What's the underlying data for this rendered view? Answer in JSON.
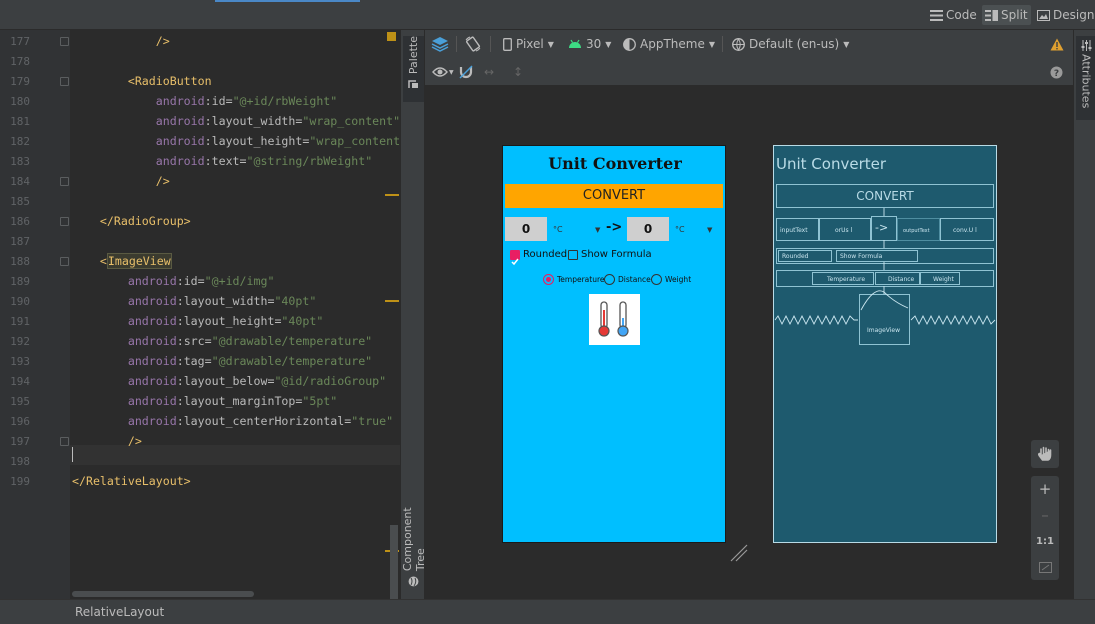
{
  "toolbar": {
    "modes": [
      {
        "label": "Code",
        "icon": "code-icon"
      },
      {
        "label": "Split",
        "icon": "split-icon",
        "active": true
      },
      {
        "label": "Design",
        "icon": "image-icon"
      }
    ]
  },
  "editor": {
    "lines": [
      {
        "n": "177",
        "parts": [
          {
            "t": "            ",
            "c": ""
          },
          {
            "t": "/>",
            "c": "tag"
          }
        ]
      },
      {
        "n": "178",
        "parts": []
      },
      {
        "n": "179",
        "parts": [
          {
            "t": "        ",
            "c": ""
          },
          {
            "t": "<RadioButton",
            "c": "tag"
          }
        ]
      },
      {
        "n": "180",
        "parts": [
          {
            "t": "            ",
            "c": ""
          },
          {
            "t": "android",
            "c": "ns"
          },
          {
            "t": ":id=",
            "c": "attr"
          },
          {
            "t": "\"@+id/rbWeight\"",
            "c": "val"
          }
        ]
      },
      {
        "n": "181",
        "parts": [
          {
            "t": "            ",
            "c": ""
          },
          {
            "t": "android",
            "c": "ns"
          },
          {
            "t": ":layout_width=",
            "c": "attr"
          },
          {
            "t": "\"wrap_content\"",
            "c": "val"
          }
        ]
      },
      {
        "n": "182",
        "parts": [
          {
            "t": "            ",
            "c": ""
          },
          {
            "t": "android",
            "c": "ns"
          },
          {
            "t": ":layout_height=",
            "c": "attr"
          },
          {
            "t": "\"wrap_content",
            "c": "val"
          }
        ]
      },
      {
        "n": "183",
        "parts": [
          {
            "t": "            ",
            "c": ""
          },
          {
            "t": "android",
            "c": "ns"
          },
          {
            "t": ":text=",
            "c": "attr"
          },
          {
            "t": "\"@string/rbWeight\"",
            "c": "val"
          }
        ]
      },
      {
        "n": "184",
        "parts": [
          {
            "t": "            ",
            "c": ""
          },
          {
            "t": "/>",
            "c": "tag"
          }
        ]
      },
      {
        "n": "185",
        "parts": []
      },
      {
        "n": "186",
        "parts": [
          {
            "t": "    ",
            "c": ""
          },
          {
            "t": "</RadioGroup>",
            "c": "tag"
          }
        ]
      },
      {
        "n": "187",
        "parts": []
      },
      {
        "n": "188",
        "parts": [
          {
            "t": "    ",
            "c": ""
          },
          {
            "t": "<",
            "c": "tag"
          },
          {
            "t": "ImageView",
            "c": "tag hl"
          }
        ]
      },
      {
        "n": "189",
        "parts": [
          {
            "t": "        ",
            "c": ""
          },
          {
            "t": "android",
            "c": "ns"
          },
          {
            "t": ":id=",
            "c": "attr"
          },
          {
            "t": "\"@+id/img\"",
            "c": "val"
          }
        ]
      },
      {
        "n": "190",
        "parts": [
          {
            "t": "        ",
            "c": ""
          },
          {
            "t": "android",
            "c": "ns"
          },
          {
            "t": ":layout_width=",
            "c": "attr"
          },
          {
            "t": "\"40pt\"",
            "c": "val"
          }
        ]
      },
      {
        "n": "191",
        "parts": [
          {
            "t": "        ",
            "c": ""
          },
          {
            "t": "android",
            "c": "ns"
          },
          {
            "t": ":layout_height=",
            "c": "attr"
          },
          {
            "t": "\"40pt\"",
            "c": "val"
          }
        ]
      },
      {
        "n": "192",
        "parts": [
          {
            "t": "        ",
            "c": ""
          },
          {
            "t": "android",
            "c": "ns"
          },
          {
            "t": ":src=",
            "c": "attr"
          },
          {
            "t": "\"@drawable/temperature\"",
            "c": "val"
          }
        ]
      },
      {
        "n": "193",
        "parts": [
          {
            "t": "        ",
            "c": ""
          },
          {
            "t": "android",
            "c": "ns"
          },
          {
            "t": ":tag=",
            "c": "attr"
          },
          {
            "t": "\"@drawable/temperature\"",
            "c": "val"
          }
        ]
      },
      {
        "n": "194",
        "parts": [
          {
            "t": "        ",
            "c": ""
          },
          {
            "t": "android",
            "c": "ns"
          },
          {
            "t": ":layout_below=",
            "c": "attr"
          },
          {
            "t": "\"@id/radioGroup\"",
            "c": "val"
          }
        ]
      },
      {
        "n": "195",
        "parts": [
          {
            "t": "        ",
            "c": ""
          },
          {
            "t": "android",
            "c": "ns"
          },
          {
            "t": ":layout_marginTop=",
            "c": "attr"
          },
          {
            "t": "\"5pt\"",
            "c": "val"
          }
        ]
      },
      {
        "n": "196",
        "parts": [
          {
            "t": "        ",
            "c": ""
          },
          {
            "t": "android",
            "c": "ns"
          },
          {
            "t": ":layout_centerHorizontal=",
            "c": "attr"
          },
          {
            "t": "\"true\"",
            "c": "val"
          }
        ]
      },
      {
        "n": "197",
        "parts": [
          {
            "t": "        ",
            "c": ""
          },
          {
            "t": "/>",
            "c": "tag"
          }
        ]
      },
      {
        "n": "198",
        "parts": []
      },
      {
        "n": "199",
        "parts": [
          {
            "t": "</RelativeLayout>",
            "c": "tag"
          }
        ]
      }
    ]
  },
  "left_panel": {
    "palette": "Palette",
    "component_tree": "Component Tree"
  },
  "right_panel": {
    "attributes": "Attributes"
  },
  "design_toolbar": {
    "device": "Pixel",
    "api": "30",
    "theme": "AppTheme",
    "locale": "Default (en-us)"
  },
  "preview": {
    "title": "Unit Converter",
    "convert": "CONVERT",
    "input_value": "0",
    "output_value": "0",
    "unit_in": "°C",
    "unit_out": "°C",
    "arrow": "->",
    "rounded": "Rounded",
    "show_formula": "Show Formula",
    "radios": [
      "Temperature",
      "Distance",
      "Weight"
    ]
  },
  "blueprint": {
    "title": "Unit Converter",
    "convert": "CONVERT",
    "input": "inputText",
    "unit_in": "orUs l",
    "arrow": "->",
    "output": "outputText",
    "unit_out": "conv.U l",
    "rounded": "Rounded",
    "show_formula": "Show Formula",
    "radios": [
      "Temperature",
      "Distance",
      "Weight"
    ],
    "image": "ImageView"
  },
  "zoom": {
    "one_to_one": "1:1"
  },
  "status": {
    "breadcrumb": "RelativeLayout"
  }
}
